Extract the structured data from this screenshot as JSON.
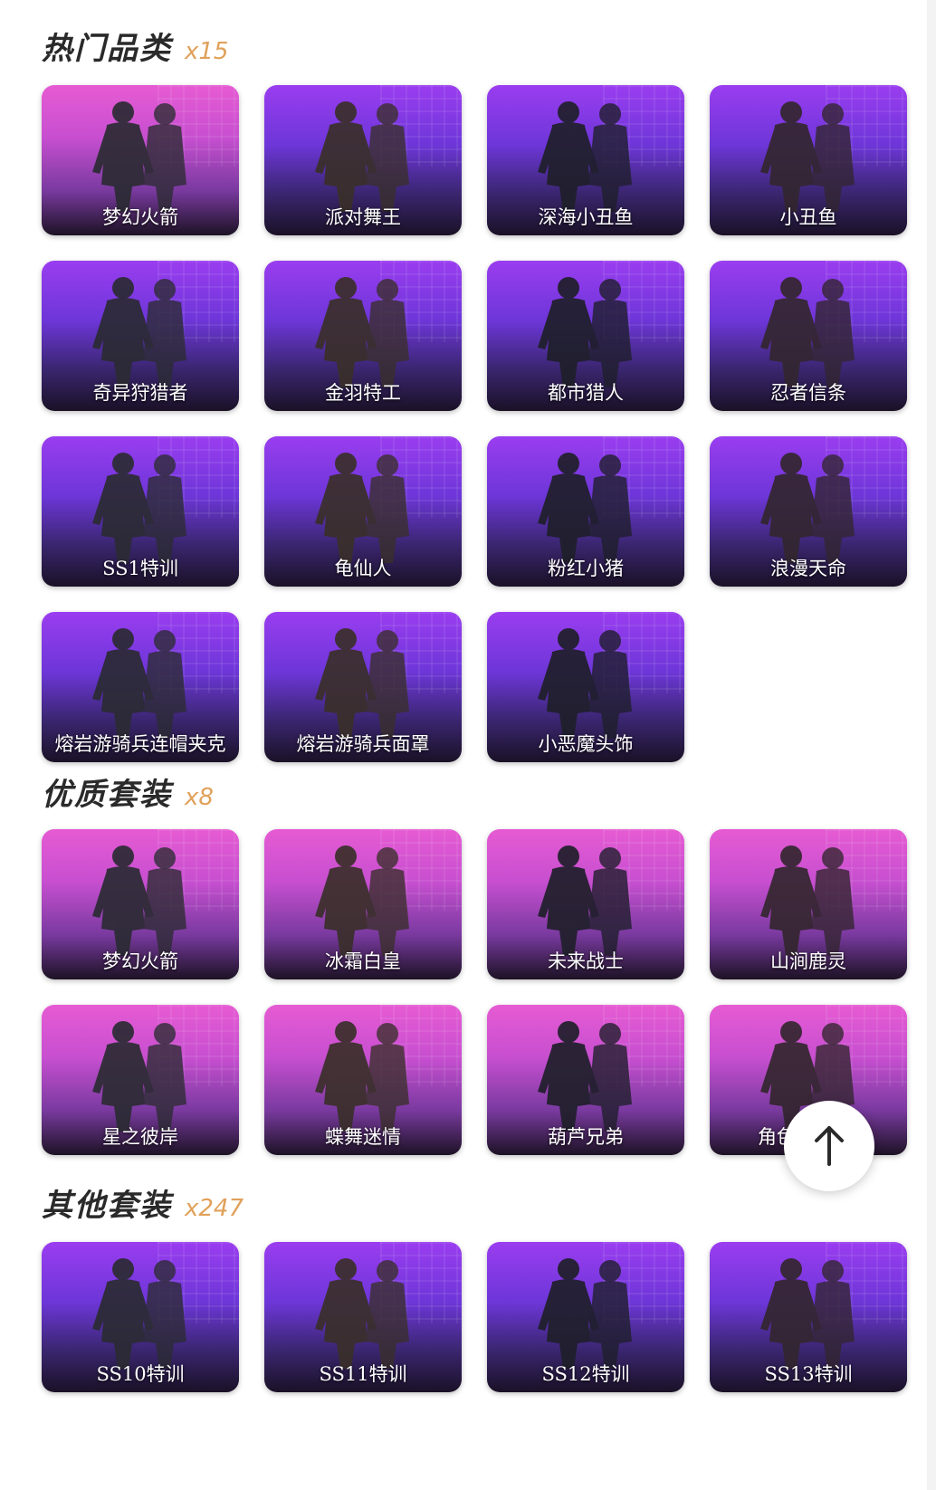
{
  "sections": [
    {
      "title": "热门品类",
      "count": "x15",
      "items": [
        {
          "label": "梦幻火箭",
          "style": "pink"
        },
        {
          "label": "派对舞王",
          "style": "purple"
        },
        {
          "label": "深海小丑鱼",
          "style": "purple"
        },
        {
          "label": "小丑鱼",
          "style": "purple"
        },
        {
          "label": "奇异狩猎者",
          "style": "purple"
        },
        {
          "label": "金羽特工",
          "style": "purple"
        },
        {
          "label": "都市猎人",
          "style": "purple"
        },
        {
          "label": "忍者信条",
          "style": "purple"
        },
        {
          "label": "SS1特训",
          "style": "purple"
        },
        {
          "label": "龟仙人",
          "style": "purple"
        },
        {
          "label": "粉红小猪",
          "style": "purple"
        },
        {
          "label": "浪漫天命",
          "style": "purple"
        },
        {
          "label": "熔岩游骑兵连帽夹克",
          "style": "purple"
        },
        {
          "label": "熔岩游骑兵面罩",
          "style": "purple"
        },
        {
          "label": "小恶魔头饰",
          "style": "purple"
        }
      ]
    },
    {
      "title": "优质套装",
      "count": "x8",
      "items": [
        {
          "label": "梦幻火箭",
          "style": "pink"
        },
        {
          "label": "冰霜白皇",
          "style": "pink"
        },
        {
          "label": "未来战士",
          "style": "pink"
        },
        {
          "label": "山涧鹿灵",
          "style": "pink"
        },
        {
          "label": "星之彼岸",
          "style": "pink"
        },
        {
          "label": "蝶舞迷情",
          "style": "pink"
        },
        {
          "label": "葫芦兄弟",
          "style": "pink"
        },
        {
          "label": "角色-鸢尾花",
          "style": "pink"
        }
      ]
    },
    {
      "title": "其他套装",
      "count": "x247",
      "items": [
        {
          "label": "SS10特训",
          "style": "purple"
        },
        {
          "label": "SS11特训",
          "style": "purple"
        },
        {
          "label": "SS12特训",
          "style": "purple"
        },
        {
          "label": "SS13特训",
          "style": "purple"
        }
      ]
    }
  ],
  "scroll_top": {
    "icon": "arrow-up-icon"
  }
}
